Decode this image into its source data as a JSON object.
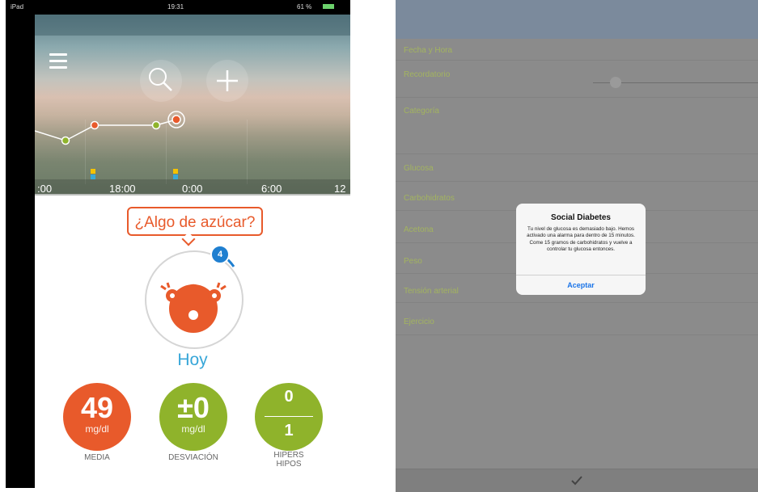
{
  "left": {
    "status_bar": {
      "left": "iPad",
      "time": "19:31",
      "battery": "61 %"
    },
    "timeline_labels": [
      ":00",
      "18:00",
      "0:00",
      "6:00",
      "12"
    ],
    "prompt": "¿Algo de azúcar?",
    "badge": "4",
    "today": "Hoy",
    "stats": {
      "media": {
        "value": "49",
        "unit": "mg/dl",
        "label": "MEDIA"
      },
      "desviacion": {
        "value": "±0",
        "unit": "mg/dl",
        "label": "DESVIACIÓN"
      },
      "hipers_hipos": {
        "top": "0",
        "bottom": "1",
        "label_top": "HIPERS",
        "label_bottom": "HIPOS"
      }
    },
    "colors": {
      "orange": "#e85a2b",
      "green": "#8fb32b",
      "blue": "#37a6d8"
    }
  },
  "right": {
    "form_labels": [
      "Fecha y Hora",
      "Recordatorio",
      "Categoría",
      "Glucosa",
      "Carbohidratos",
      "Acetona",
      "Peso",
      "Tensión arterial",
      "Ejercicio"
    ],
    "dialog": {
      "title": "Social Diabetes",
      "message": "Tu nivel de glucosa es demasiado bajo. Hemos activado una alarma para dentro de 15 minutos. Come 15 gramos de carbohidratos y vuelve a controlar tu glucosa entonces.",
      "button": "Aceptar"
    },
    "bottom_icon": "checkmark-icon"
  }
}
